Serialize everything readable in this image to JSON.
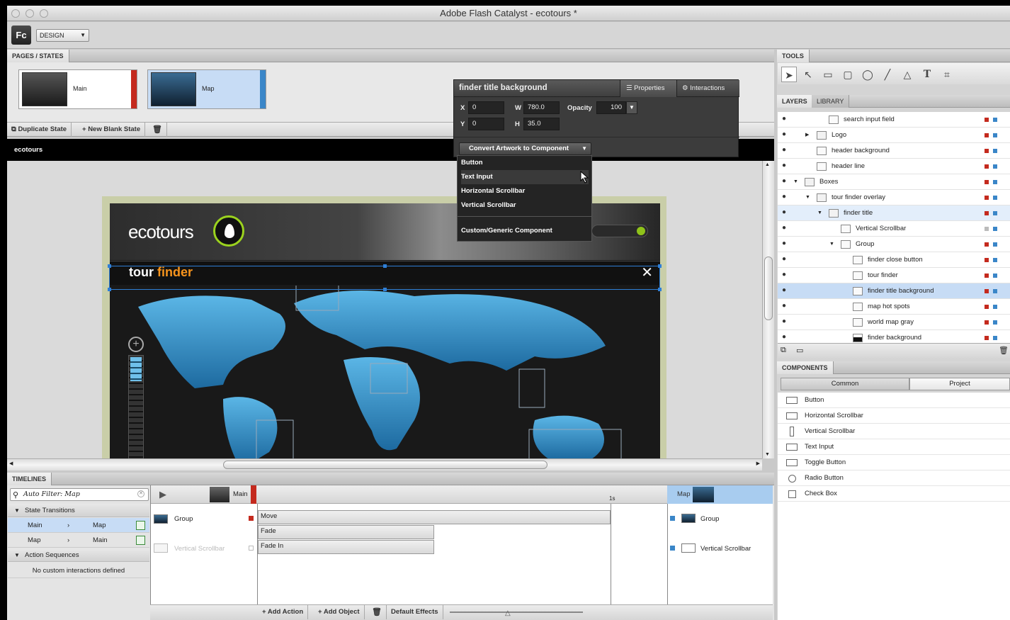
{
  "window": {
    "title": "Adobe Flash Catalyst - ecotours *"
  },
  "menubar": {
    "app_logo": "Fc",
    "workspace": "DESIGN"
  },
  "pages": {
    "tab": "PAGES / STATES",
    "thumbs": [
      {
        "label": "Main"
      },
      {
        "label": "Map"
      }
    ],
    "buttons": {
      "duplicate": "Duplicate State",
      "new_blank": "New Blank State"
    }
  },
  "document": {
    "tab": "ecotours"
  },
  "artwork": {
    "logo_text": "ecotours",
    "title_white": "tour ",
    "title_orange": "finder",
    "close_glyph": "✕"
  },
  "properties": {
    "title": "finder title background",
    "tab_properties": "Properties",
    "tab_interactions": "Interactions",
    "x_label": "X",
    "x_value": "0",
    "y_label": "Y",
    "y_value": "0",
    "w_label": "W",
    "w_value": "780.0",
    "h_label": "H",
    "h_value": "35.0",
    "opacity_label": "Opacity",
    "opacity_value": "100",
    "convert_label": "Convert Artwork to Component"
  },
  "convert_menu": {
    "items": [
      "Button",
      "Text Input",
      "Horizontal Scrollbar",
      "Vertical Scrollbar"
    ],
    "custom": "Custom/Generic Component"
  },
  "timelines": {
    "tab": "TIMELINES",
    "filter_placeholder": "Auto Filter: Map",
    "state_transitions": "State Transitions",
    "transitions": [
      {
        "from": "Main",
        "to": "Map"
      },
      {
        "from": "Map",
        "to": "Main"
      }
    ],
    "action_sequences": "Action Sequences",
    "no_interactions": "No custom interactions defined",
    "start_state": "Main",
    "end_state": "Map",
    "time_marker": "1s",
    "objects": [
      "Group",
      "Vertical Scrollbar"
    ],
    "effects": [
      "Move",
      "Fade",
      "Fade In"
    ],
    "end_objects": [
      "Group",
      "Vertical Scrollbar"
    ],
    "buttons": {
      "add_action": "Add Action",
      "add_object": "Add Object",
      "default_effects": "Default Effects"
    }
  },
  "tools": {
    "tab": "TOOLS"
  },
  "layers": {
    "tab_layers": "LAYERS",
    "tab_library": "LIBRARY",
    "rows": [
      {
        "label": "search input field",
        "depth": 4
      },
      {
        "label": "Logo",
        "depth": 3
      },
      {
        "label": "header background",
        "depth": 3
      },
      {
        "label": "header line",
        "depth": 3
      },
      {
        "label": "Boxes",
        "depth": 2
      },
      {
        "label": "tour finder overlay",
        "depth": 3
      },
      {
        "label": "finder title",
        "depth": 4
      },
      {
        "label": "Vertical Scrollbar",
        "depth": 5
      },
      {
        "label": "Group",
        "depth": 5
      },
      {
        "label": "finder close button",
        "depth": 6
      },
      {
        "label": "tour finder",
        "depth": 6
      },
      {
        "label": "finder title background",
        "depth": 6
      },
      {
        "label": "map hot spots",
        "depth": 6
      },
      {
        "label": "world map gray",
        "depth": 6
      },
      {
        "label": "finder background",
        "depth": 6
      }
    ]
  },
  "components": {
    "tab": "COMPONENTS",
    "tab_common": "Common",
    "tab_project": "Project",
    "items": [
      "Button",
      "Horizontal Scrollbar",
      "Vertical Scrollbar",
      "Text Input",
      "Toggle Button",
      "Radio Button",
      "Check Box"
    ]
  }
}
